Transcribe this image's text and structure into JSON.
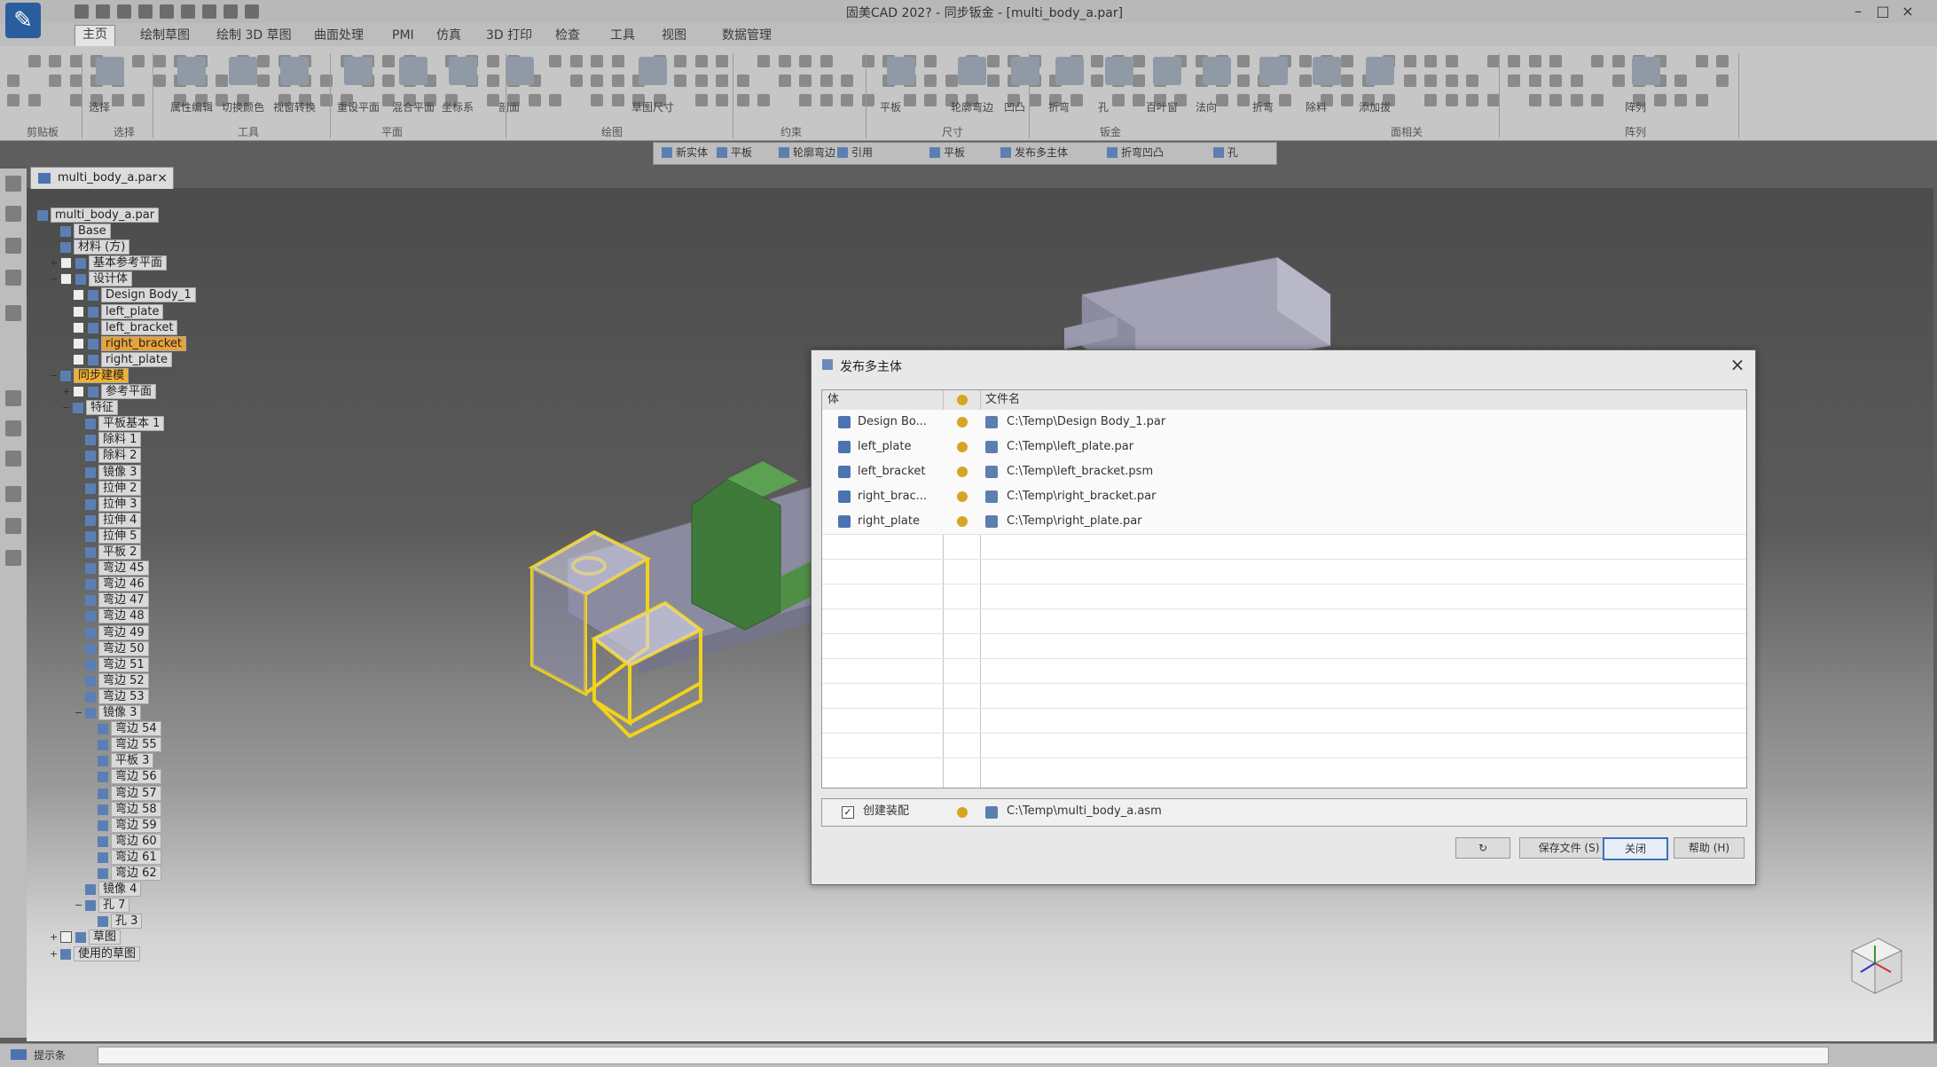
{
  "app": {
    "window_title": "固美CAD 202? - 同步钣金 - [multi_body_a.par]",
    "logo_glyph": "✎"
  },
  "menu": {
    "tabs": [
      "主页",
      "绘制草图",
      "绘制 3D 草图",
      "曲面处理",
      "PMI",
      "仿真",
      "3D 打印",
      "检查",
      "工具",
      "视图",
      "数据管理"
    ],
    "active_index": 0
  },
  "ribbon": {
    "big_labels": [
      "选择",
      "属性编辑",
      "切换颜色",
      "视窗转换",
      "重设平面",
      "混合平面",
      "坐标系",
      "剖面",
      "草图尺寸",
      "平板",
      "轮廓弯边",
      "凹凸",
      "折弯",
      "孔",
      "百叶窗",
      "法向",
      "折弯",
      "除料",
      "添加拔",
      "阵列"
    ],
    "group_labels": [
      "剪贴板",
      "选择",
      "工具",
      "平面",
      "绘图",
      "约束",
      "尺寸",
      "钣金",
      "面相关",
      "阵列"
    ]
  },
  "command_bar": {
    "items": [
      "新实体",
      "平板",
      "轮廓弯边",
      "引用",
      "平板",
      "发布多主体",
      "折弯凹凸",
      "孔"
    ]
  },
  "document": {
    "tab_label": "multi_body_a.par",
    "close_glyph": "×"
  },
  "tree": {
    "root": "multi_body_a.par",
    "items": [
      {
        "label": "Base",
        "indent": 1,
        "cb": false,
        "exp": ""
      },
      {
        "label": "材料 (方)",
        "indent": 1,
        "cb": false,
        "exp": ""
      },
      {
        "label": "基本参考平面",
        "indent": 1,
        "cb": true,
        "exp": "+"
      },
      {
        "label": "设计体",
        "indent": 1,
        "cb": true,
        "exp": "−"
      },
      {
        "label": "Design Body_1",
        "indent": 2,
        "cb": true,
        "exp": ""
      },
      {
        "label": "left_plate",
        "indent": 2,
        "cb": true,
        "exp": ""
      },
      {
        "label": "left_bracket",
        "indent": 2,
        "cb": true,
        "exp": ""
      },
      {
        "label": "right_bracket",
        "indent": 2,
        "cb": true,
        "exp": "",
        "state": "sel"
      },
      {
        "label": "right_plate",
        "indent": 2,
        "cb": true,
        "exp": ""
      },
      {
        "label": "同步建模",
        "indent": 1,
        "cb": false,
        "exp": "−",
        "state": "hl"
      },
      {
        "label": "参考平面",
        "indent": 2,
        "cb": true,
        "exp": "+"
      },
      {
        "label": "特征",
        "indent": 2,
        "cb": false,
        "exp": "−"
      },
      {
        "label": "平板基本 1",
        "indent": 3,
        "cb": false,
        "exp": ""
      },
      {
        "label": "除料 1",
        "indent": 3,
        "cb": false,
        "exp": ""
      },
      {
        "label": "除料 2",
        "indent": 3,
        "cb": false,
        "exp": ""
      },
      {
        "label": "镜像 3",
        "indent": 3,
        "cb": false,
        "exp": ""
      },
      {
        "label": "拉伸 2",
        "indent": 3,
        "cb": false,
        "exp": ""
      },
      {
        "label": "拉伸 3",
        "indent": 3,
        "cb": false,
        "exp": ""
      },
      {
        "label": "拉伸 4",
        "indent": 3,
        "cb": false,
        "exp": ""
      },
      {
        "label": "拉伸 5",
        "indent": 3,
        "cb": false,
        "exp": ""
      },
      {
        "label": "平板 2",
        "indent": 3,
        "cb": false,
        "exp": ""
      },
      {
        "label": "弯边 45",
        "indent": 3,
        "cb": false,
        "exp": ""
      },
      {
        "label": "弯边 46",
        "indent": 3,
        "cb": false,
        "exp": ""
      },
      {
        "label": "弯边 47",
        "indent": 3,
        "cb": false,
        "exp": ""
      },
      {
        "label": "弯边 48",
        "indent": 3,
        "cb": false,
        "exp": ""
      },
      {
        "label": "弯边 49",
        "indent": 3,
        "cb": false,
        "exp": ""
      },
      {
        "label": "弯边 50",
        "indent": 3,
        "cb": false,
        "exp": ""
      },
      {
        "label": "弯边 51",
        "indent": 3,
        "cb": false,
        "exp": ""
      },
      {
        "label": "弯边 52",
        "indent": 3,
        "cb": false,
        "exp": ""
      },
      {
        "label": "弯边 53",
        "indent": 3,
        "cb": false,
        "exp": ""
      },
      {
        "label": "镜像 3",
        "indent": 3,
        "cb": false,
        "exp": "−"
      },
      {
        "label": "弯边 54",
        "indent": 4,
        "cb": false,
        "exp": ""
      },
      {
        "label": "弯边 55",
        "indent": 4,
        "cb": false,
        "exp": ""
      },
      {
        "label": "平板 3",
        "indent": 4,
        "cb": false,
        "exp": ""
      },
      {
        "label": "弯边 56",
        "indent": 4,
        "cb": false,
        "exp": ""
      },
      {
        "label": "弯边 57",
        "indent": 4,
        "cb": false,
        "exp": ""
      },
      {
        "label": "弯边 58",
        "indent": 4,
        "cb": false,
        "exp": ""
      },
      {
        "label": "弯边 59",
        "indent": 4,
        "cb": false,
        "exp": ""
      },
      {
        "label": "弯边 60",
        "indent": 4,
        "cb": false,
        "exp": ""
      },
      {
        "label": "弯边 61",
        "indent": 4,
        "cb": false,
        "exp": ""
      },
      {
        "label": "弯边 62",
        "indent": 4,
        "cb": false,
        "exp": ""
      },
      {
        "label": "镜像 4",
        "indent": 3,
        "cb": false,
        "exp": ""
      },
      {
        "label": "孔 7",
        "indent": 3,
        "cb": false,
        "exp": "−"
      },
      {
        "label": "孔 3",
        "indent": 4,
        "cb": false,
        "exp": ""
      },
      {
        "label": "草图",
        "indent": 1,
        "cb": true,
        "exp": "+"
      },
      {
        "label": "使用的草图",
        "indent": 1,
        "cb": false,
        "exp": "+"
      }
    ]
  },
  "dialog": {
    "title": "发布多主体",
    "close_glyph": "×",
    "columns": {
      "body": "体",
      "file": "文件名"
    },
    "rows": [
      {
        "body": "Design Bo...",
        "file": "C:\\Temp\\Design Body_1.par"
      },
      {
        "body": "left_plate",
        "file": "C:\\Temp\\left_plate.par"
      },
      {
        "body": "left_bracket",
        "file": "C:\\Temp\\left_bracket.psm"
      },
      {
        "body": "right_brac...",
        "file": "C:\\Temp\\right_bracket.par"
      },
      {
        "body": "right_plate",
        "file": "C:\\Temp\\right_plate.par"
      }
    ],
    "assembly": {
      "label": "创建装配",
      "file": "C:\\Temp\\multi_body_a.asm",
      "checked": true
    },
    "buttons": {
      "save": "保存文件 (S)",
      "close": "关闭",
      "help": "帮助 (H)"
    }
  },
  "statusbar": {
    "label": "提示条"
  },
  "colors": {
    "selection_yellow": "#f2d21a",
    "selected_tree": "#e8a23b",
    "green_face": "#4f8f45",
    "body_gray": "#a8a8b8"
  }
}
